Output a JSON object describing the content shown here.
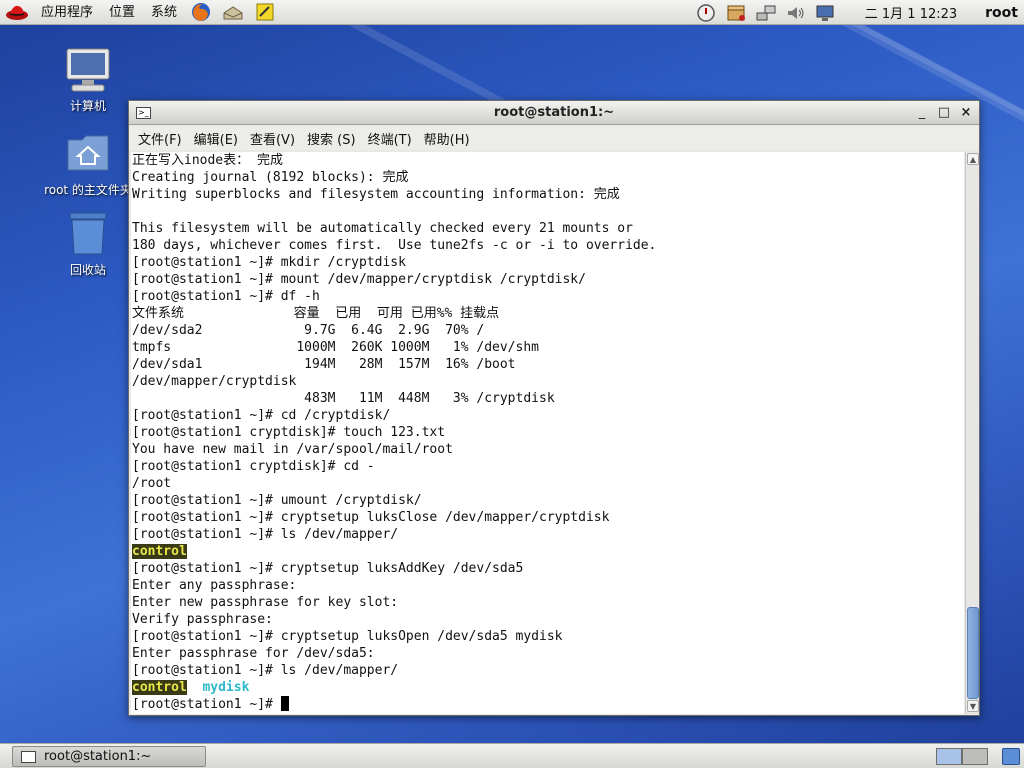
{
  "top_panel": {
    "menus": [
      "应用程序",
      "位置",
      "系统"
    ],
    "launchers": [
      "firefox-icon",
      "mail-icon",
      "notes-icon"
    ],
    "tray_icons": [
      "update-icon",
      "package-icon",
      "network-icon",
      "volume-icon",
      "display-icon"
    ],
    "clock": "二  1月  1 12:23",
    "user": "root"
  },
  "desktop": {
    "icons": [
      {
        "label": "计算机",
        "icon": "computer-icon"
      },
      {
        "label": "root 的主文件夹",
        "icon": "home-folder-icon"
      },
      {
        "label": "回收站",
        "icon": "trash-icon"
      }
    ]
  },
  "window": {
    "title": "root@station1:~",
    "controls": {
      "minimize": "_",
      "maximize": "□",
      "close": "×"
    },
    "menus": [
      "文件(F)",
      "编辑(E)",
      "查看(V)",
      "搜索 (S)",
      "终端(T)",
      "帮助(H)"
    ]
  },
  "terminal": {
    "lines": [
      "正在写入inode表： 完成",
      "Creating journal (8192 blocks): 完成",
      "Writing superblocks and filesystem accounting information: 完成",
      "",
      "This filesystem will be automatically checked every 21 mounts or",
      "180 days, whichever comes first.  Use tune2fs -c or -i to override.",
      "[root@station1 ~]# mkdir /cryptdisk",
      "[root@station1 ~]# mount /dev/mapper/cryptdisk /cryptdisk/",
      "[root@station1 ~]# df -h",
      "文件系统              容量  已用  可用 已用%% 挂载点",
      "/dev/sda2             9.7G  6.4G  2.9G  70% /",
      "tmpfs                1000M  260K 1000M   1% /dev/shm",
      "/dev/sda1             194M   28M  157M  16% /boot",
      "/dev/mapper/cryptdisk",
      "                      483M   11M  448M   3% /cryptdisk",
      "[root@station1 ~]# cd /cryptdisk/",
      "[root@station1 cryptdisk]# touch 123.txt",
      "You have new mail in /var/spool/mail/root",
      "[root@station1 cryptdisk]# cd -",
      "/root",
      "[root@station1 ~]# umount /cryptdisk/",
      "[root@station1 ~]# cryptsetup luksClose /dev/mapper/cryptdisk",
      "[root@station1 ~]# ls /dev/mapper/"
    ],
    "ls1_control": "control",
    "lines2": [
      "[root@station1 ~]# cryptsetup luksAddKey /dev/sda5",
      "Enter any passphrase:",
      "Enter new passphrase for key slot:",
      "Verify passphrase:",
      "[root@station1 ~]# cryptsetup luksOpen /dev/sda5 mydisk",
      "Enter passphrase for /dev/sda5:",
      "[root@station1 ~]# ls /dev/mapper/"
    ],
    "ls2_control": "control",
    "ls2_mydisk": "mydisk",
    "prompt": "[root@station1 ~]# "
  },
  "taskbar": {
    "window_button": "root@station1:~"
  }
}
